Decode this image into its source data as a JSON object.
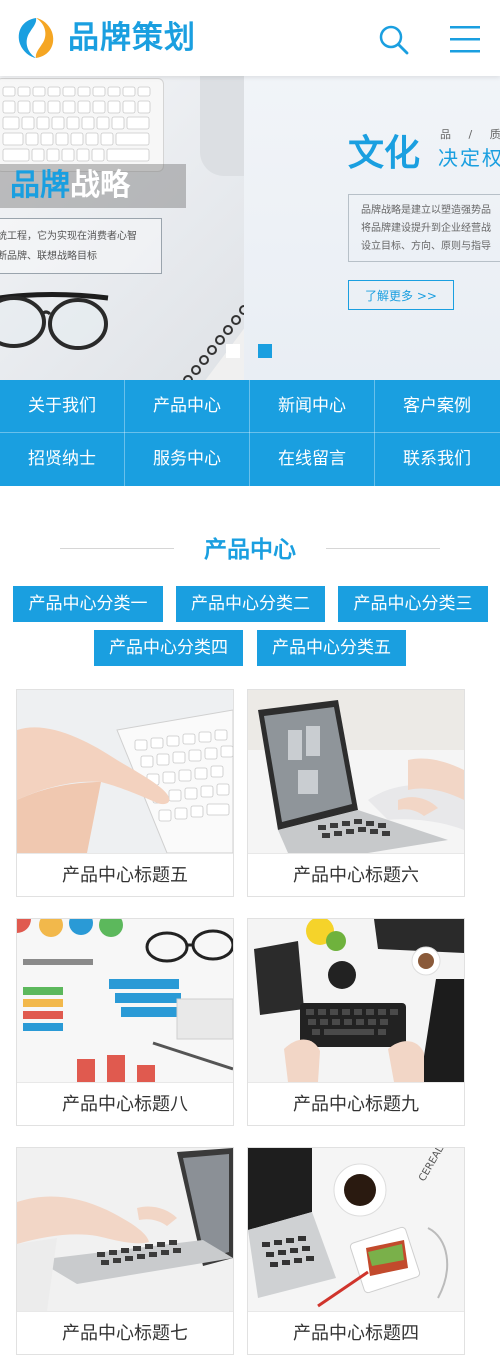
{
  "header": {
    "brand": "品牌策划",
    "logo_icon": "logo-icon",
    "search_icon": "search-icon",
    "menu_icon": "menu-icon"
  },
  "banner": {
    "left_slide": {
      "title_part1": "品牌",
      "title_part2": "战略",
      "text_lines": [
        "统工程，它为实现在消费者心智",
        "断品牌、联想战略目标"
      ]
    },
    "right_slide": {
      "title": "文化",
      "small_chars": "品 / 质 /",
      "subtitle": "决定权",
      "text_lines": [
        "品牌战略是建立以塑造强势品",
        "将品牌建设提升到企业经营战",
        "设立目标、方向、原则与指导"
      ],
      "more_button": "了解更多 >>"
    },
    "slide_count": 2,
    "active_slide": 2
  },
  "nav": {
    "items": [
      "关于我们",
      "产品中心",
      "新闻中心",
      "客户案例",
      "招贤纳士",
      "服务中心",
      "在线留言",
      "联系我们"
    ]
  },
  "products": {
    "title": "产品中心",
    "categories": [
      "产品中心分类一",
      "产品中心分类二",
      "产品中心分类三",
      "产品中心分类四",
      "产品中心分类五"
    ],
    "items": [
      {
        "title": "产品中心标题五",
        "image": "hand-on-keyboard-photo"
      },
      {
        "title": "产品中心标题六",
        "image": "laptop-typing-photo"
      },
      {
        "title": "产品中心标题八",
        "image": "charts-and-glasses-photo"
      },
      {
        "title": "产品中心标题九",
        "image": "desk-keyboard-flatlay-photo"
      },
      {
        "title": "产品中心标题七",
        "image": "laptop-hands-photo"
      },
      {
        "title": "产品中心标题四",
        "image": "desk-coffee-sandwich-photo"
      }
    ]
  },
  "colors": {
    "accent": "#1a9fe0",
    "white": "#ffffff",
    "text": "#333333"
  }
}
